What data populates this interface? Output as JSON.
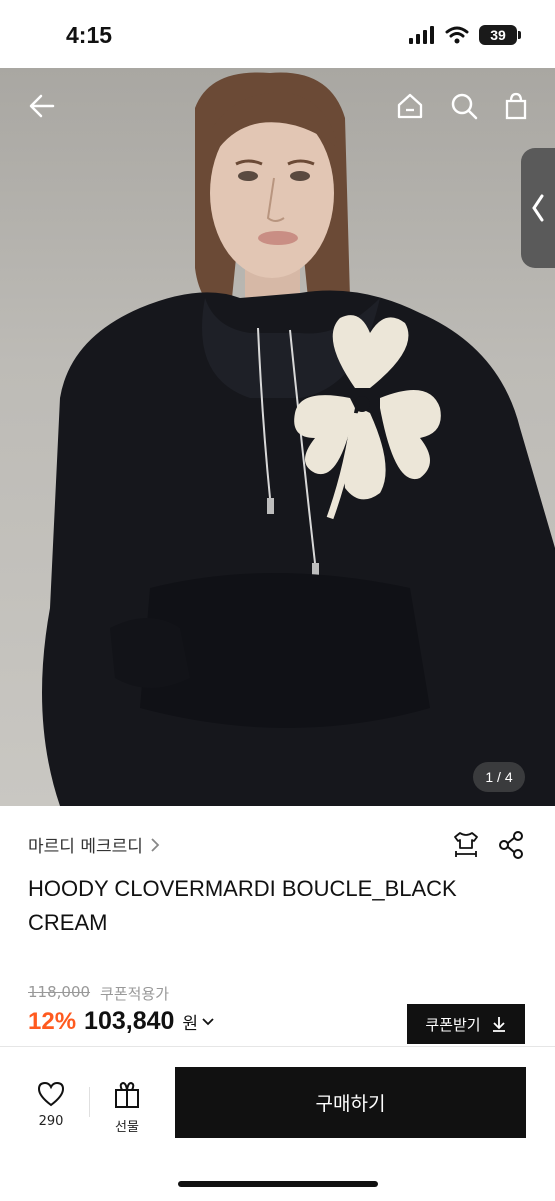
{
  "status": {
    "time": "4:15",
    "battery": "39"
  },
  "gallery": {
    "counter": "1 / 4"
  },
  "product": {
    "brand": "마르디 메크르디",
    "title": "HOODY CLOVERMARDI BOUCLE_BLACK CREAM",
    "original_price": "118,000",
    "coupon_price_label": "쿠폰적용가",
    "discount": "12%",
    "price": "103,840",
    "currency": "원"
  },
  "coupon": {
    "label": "쿠폰받기"
  },
  "bottom": {
    "likes": "290",
    "gift_label": "선물",
    "buy_label": "구매하기"
  },
  "colors": {
    "accent": "#ff5a1f",
    "primary": "#111111"
  }
}
